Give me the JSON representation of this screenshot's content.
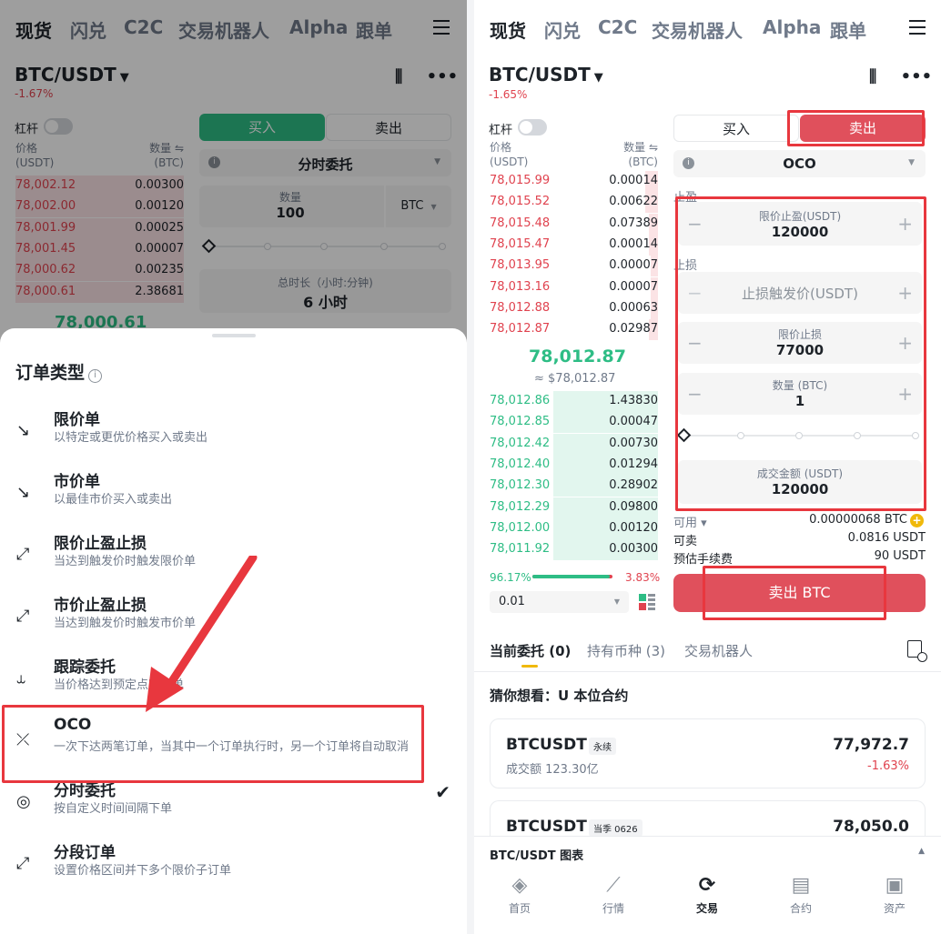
{
  "left": {
    "nav": [
      "现货",
      "闪兑",
      "C2C",
      "交易机器人",
      "Alpha",
      "跟单"
    ],
    "pair": "BTC/USDT",
    "change": "-1.67%",
    "leverage": "杠杆",
    "ob_price_header": "价格",
    "ob_price_unit": "(USDT)",
    "ob_qty_header": "数量 ⇋",
    "ob_qty_unit": "(BTC)",
    "asks": [
      {
        "price": "78,002.12",
        "qty": "0.00300"
      },
      {
        "price": "78,002.00",
        "qty": "0.00120"
      },
      {
        "price": "78,001.99",
        "qty": "0.00025"
      },
      {
        "price": "78,001.45",
        "qty": "0.00007"
      },
      {
        "price": "78,000.62",
        "qty": "0.00235"
      },
      {
        "price": "78,000.61",
        "qty": "2.38681"
      }
    ],
    "mid_price": "78,000.61",
    "buy": "买入",
    "sell": "卖出",
    "order_type": "分时委托",
    "qty_label": "数量",
    "qty_value": "100",
    "qty_unit": "BTC",
    "duration_label": "总时长（小时:分钟)",
    "duration_value": "6 小时",
    "sheet": {
      "title": "订单类型",
      "types": [
        {
          "name": "限价单",
          "desc": "以特定或更优价格买入或卖出"
        },
        {
          "name": "市价单",
          "desc": "以最佳市价买入或卖出"
        },
        {
          "name": "限价止盈止损",
          "desc": "当达到触发价时触发限价单"
        },
        {
          "name": "市价止盈止损",
          "desc": "当达到触发价时触发市价单"
        },
        {
          "name": "跟踪委托",
          "desc": "当价格达到预定点时下单"
        },
        {
          "name": "OCO",
          "desc": "一次下达两笔订单，当其中一个订单执行时，另一个订单将自动取消"
        },
        {
          "name": "分时委托",
          "desc": "按自定义时间间隔下单"
        },
        {
          "name": "分段订单",
          "desc": "设置价格区间并下多个限价子订单"
        }
      ]
    }
  },
  "right": {
    "nav": [
      "现货",
      "闪兑",
      "C2C",
      "交易机器人",
      "Alpha",
      "跟单"
    ],
    "pair": "BTC/USDT",
    "change": "-1.65%",
    "leverage": "杠杆",
    "ob_price_header": "价格",
    "ob_price_unit": "(USDT)",
    "ob_qty_header": "数量 ⇋",
    "ob_qty_unit": "(BTC)",
    "asks": [
      {
        "price": "78,015.99",
        "qty": "0.00014"
      },
      {
        "price": "78,015.52",
        "qty": "0.00622"
      },
      {
        "price": "78,015.48",
        "qty": "0.07389"
      },
      {
        "price": "78,015.47",
        "qty": "0.00014"
      },
      {
        "price": "78,013.95",
        "qty": "0.00007"
      },
      {
        "price": "78,013.16",
        "qty": "0.00007"
      },
      {
        "price": "78,012.88",
        "qty": "0.00063"
      },
      {
        "price": "78,012.87",
        "qty": "0.02987"
      }
    ],
    "mid_price": "78,012.87",
    "mid_usd": "≈ $78,012.87",
    "bids": [
      {
        "price": "78,012.86",
        "qty": "1.43830"
      },
      {
        "price": "78,012.85",
        "qty": "0.00047"
      },
      {
        "price": "78,012.42",
        "qty": "0.00730"
      },
      {
        "price": "78,012.40",
        "qty": "0.01294"
      },
      {
        "price": "78,012.30",
        "qty": "0.28902"
      },
      {
        "price": "78,012.29",
        "qty": "0.09800"
      },
      {
        "price": "78,012.00",
        "qty": "0.00120"
      },
      {
        "price": "78,011.92",
        "qty": "0.00300"
      }
    ],
    "buy_ratio": "96.17%",
    "sell_ratio": "3.83%",
    "buy_ratio_value": 0.9617,
    "precision": "0.01",
    "buy": "买入",
    "sell": "卖出",
    "order_type": "OCO",
    "take_profit_label": "止盈",
    "tp_limit_label": "限价止盈(USDT)",
    "tp_limit_value": "120000",
    "stop_loss_label": "止损",
    "sl_trigger_placeholder": "止损触发价(USDT)",
    "sl_limit_label": "限价止损",
    "sl_limit_value": "77000",
    "qty_label": "数量 (BTC)",
    "qty_value": "1",
    "amount_label": "成交金额 (USDT)",
    "amount_value": "120000",
    "available_label": "可用 ▾",
    "available_value": "0.00000068 BTC",
    "sellable_label": "可卖",
    "sellable_value": "0.0816 USDT",
    "fee_label": "预估手续费",
    "fee_value": "90 USDT",
    "sell_button": "卖出 BTC",
    "tabs": [
      "当前委托 (0)",
      "持有币种 (3)",
      "交易机器人"
    ],
    "guess": "猜你想看：U 本位合约",
    "cards": [
      {
        "symbol": "BTCUSDT",
        "tag": "永续",
        "vol": "成交额 123.30亿",
        "price": "77,972.7",
        "pct": "-1.63%"
      },
      {
        "symbol": "BTCUSDT",
        "tag": "当季 0626",
        "price": "78,050.0"
      }
    ],
    "chart_bar": "BTC/USDT 图表",
    "bottom_nav": [
      "首页",
      "行情",
      "交易",
      "合约",
      "资产"
    ]
  }
}
